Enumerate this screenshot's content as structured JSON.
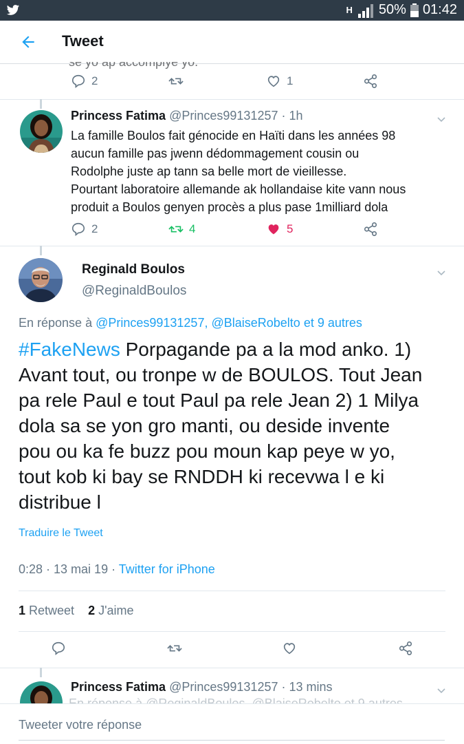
{
  "status_bar": {
    "battery": "50%",
    "time": "01:42",
    "signal_label": "H"
  },
  "app_bar": {
    "title": "Tweet"
  },
  "previous_tweet": {
    "fragment": "se yo ap accomplye yo.",
    "replies": "2",
    "likes": "1"
  },
  "tweet1": {
    "name": "Princess Fatima",
    "handle": "@Princes99131257",
    "time": " · 1h",
    "lines": [
      "La famille Boulos fait génocide en Haïti dans les années 98",
      "aucun famille pas jwenn dédommagement cousin ou",
      "Rodolphe juste ap tann sa belle mort de vieillesse.",
      "Pourtant laboratoire allemande ak hollandaise kite vann nous",
      "produit a Boulos genyen procès a plus pase 1milliard dola"
    ],
    "replies": "2",
    "retweets": "4",
    "likes": "5"
  },
  "main_tweet": {
    "name": "Reginald Boulos",
    "handle": "@ReginaldBoulos",
    "reply_prefix": "En réponse à ",
    "reply_users": "@Princes99131257, @BlaiseRobelto",
    "reply_suffix": " et 9 autres",
    "hashtag": "#FakeNews",
    "lines": [
      " Porpagande pa a la mod anko. 1)",
      "Avant tout, ou tronpe w de BOULOS. Tout Jean",
      "pa rele Paul e tout Paul pa rele Jean 2) 1 Milya",
      "dola sa se yon gro manti, ou deside invente",
      "pou ou ka fe buzz pou moun kap peye w yo,",
      "tout kob ki bay se RNDDH ki recevwa l e ki",
      "distribue l"
    ],
    "translate": "Traduire le Tweet",
    "timestamp": "0:28 · 13 mai 19 · ",
    "source": "Twitter for iPhone",
    "retweet_count": "1",
    "retweet_label": " Retweet",
    "like_count": "2",
    "like_label": " J'aime"
  },
  "next_tweet": {
    "name": "Princess Fatima",
    "handle": "@Princes99131257",
    "time": " · 13 mins",
    "fragment": "En réponse à @ReginaldBoulos, @BlaiseRobelto et 9 autres"
  },
  "reply_input": {
    "placeholder": "Tweeter votre réponse"
  },
  "colors": {
    "accent": "#1da1f2",
    "retweet": "#17bf63",
    "like": "#e0245e",
    "status_bar": "#2e3b47"
  },
  "icons": [
    "twitter-bird-icon",
    "back-arrow-icon",
    "reply-icon",
    "retweet-icon",
    "heart-icon",
    "share-icon",
    "chevron-down-icon"
  ]
}
